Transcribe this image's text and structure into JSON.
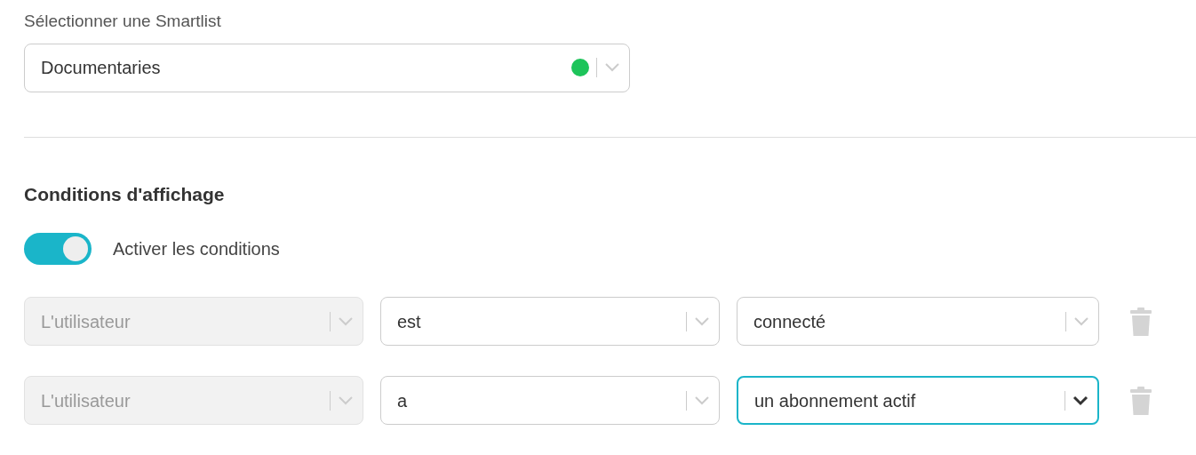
{
  "smartlist": {
    "label": "Sélectionner une Smartlist",
    "value": "Documentaries",
    "active": true
  },
  "conditions": {
    "title": "Conditions d'affichage",
    "toggle": {
      "label": "Activer les conditions",
      "on": true
    },
    "rows": [
      {
        "fields": [
          {
            "value": "L'utilisateur",
            "disabled": true,
            "focused": false
          },
          {
            "value": "est",
            "disabled": false,
            "focused": false
          },
          {
            "value": "connecté",
            "disabled": false,
            "focused": false
          }
        ]
      },
      {
        "fields": [
          {
            "value": "L'utilisateur",
            "disabled": true,
            "focused": false
          },
          {
            "value": "a",
            "disabled": false,
            "focused": false
          },
          {
            "value": "un abonnement actif",
            "disabled": false,
            "focused": true
          }
        ]
      }
    ]
  }
}
